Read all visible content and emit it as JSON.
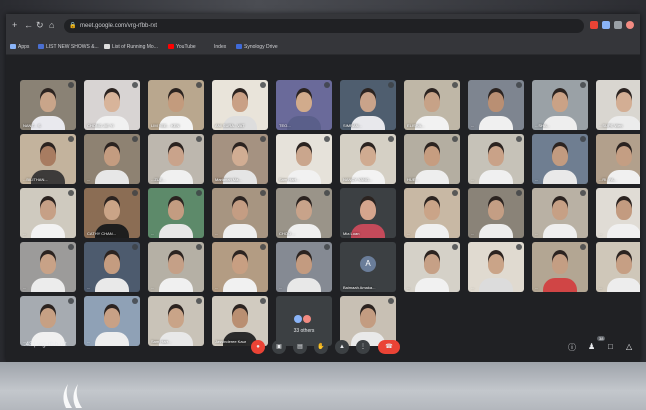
{
  "browser": {
    "url": "meet.google.com/vrg-rfbb-rxt",
    "bookmarks": [
      {
        "label": "Apps"
      },
      {
        "label": "LIST NEW SHOWS &..."
      },
      {
        "label": "List of Running Mo..."
      },
      {
        "label": "YouTube"
      },
      {
        "label": "Index"
      },
      {
        "label": "Synology Drive"
      }
    ]
  },
  "meeting": {
    "time": ":43",
    "code": "vrg-rfbb-rxt",
    "participant_count": "38"
  },
  "participants": [
    {
      "name": "NANT... S",
      "bg": "#8a8275",
      "skin": "#c9a58a",
      "shirt": "#e9e9ee",
      "type": "video"
    },
    {
      "name": "CHONG JIE YI",
      "bg": "#d8d4d3",
      "skin": "#d8b49a",
      "shirt": "#f1f1f1",
      "type": "video"
    },
    {
      "name": "LIM YEE... KEN",
      "bg": "#b9a78e",
      "skin": "#c39b7d",
      "shirt": "#f4f4f4",
      "type": "video"
    },
    {
      "name": "ANI SURA...VAT",
      "bg": "#e9e4da",
      "skin": "#c9a085",
      "shirt": "#dddddd",
      "type": "video"
    },
    {
      "name": "TEO...",
      "bg": "#6a6a9a",
      "skin": "#d1ab8c",
      "shirt": "#5a5f8a",
      "type": "video"
    },
    {
      "name": "SIMRAN...",
      "bg": "#4f5e6f",
      "skin": "#c9a38a",
      "shirt": "#e8e8ec",
      "type": "video"
    },
    {
      "name": "ELISHA...",
      "bg": "#bfb7a7",
      "skin": "#c7a287",
      "shirt": "#f2f2f2",
      "type": "video"
    },
    {
      "name": "...",
      "bg": "#7e8590",
      "skin": "#b98f73",
      "shirt": "#f0f0f0",
      "type": "video"
    },
    {
      "name": "...SHA...",
      "bg": "#9aa1a6",
      "skin": "#caa286",
      "shirt": "#eeeeee",
      "type": "video"
    },
    {
      "name": "...SUPE Wen",
      "bg": "#d9d6d0",
      "skin": "#d3ae94",
      "shirt": "#ececec",
      "type": "video"
    },
    {
      "name": "...BILITHAN...",
      "bg": "#c3b39d",
      "skin": "#a87c61",
      "shirt": "#3d3b3a",
      "type": "video"
    },
    {
      "name": "...",
      "bg": "#8e8272",
      "skin": "#c49c80",
      "shirt": "#e7e7e7",
      "type": "video"
    },
    {
      "name": "...ZUE...",
      "bg": "#bdb7ae",
      "skin": "#c9a38b",
      "shirt": "#f0f0f0",
      "type": "video"
    },
    {
      "name": "Marianah Ma...",
      "bg": "#a59281",
      "skin": "#d1ad93",
      "shirt": "#e5e5e5",
      "type": "video"
    },
    {
      "name": "Sam Hart...",
      "bg": "#e6e2da",
      "skin": "#caa68d",
      "shirt": "#f1f1f1",
      "type": "video"
    },
    {
      "name": "NANCY YANG...",
      "bg": "#d5d0c5",
      "skin": "#d0ab91",
      "shirt": "#f3f3f3",
      "type": "video"
    },
    {
      "name": "HUE...",
      "bg": "#b4aea1",
      "skin": "#c69d80",
      "shirt": "#eeeeee",
      "type": "video"
    },
    {
      "name": "...",
      "bg": "#c6c2b8",
      "skin": "#c9a288",
      "shirt": "#f0f0f0",
      "type": "video"
    },
    {
      "name": "...",
      "bg": "#6f7e91",
      "skin": "#c29b80",
      "shirt": "#e9e9e9",
      "type": "video"
    },
    {
      "name": "...RI..YA...",
      "bg": "#b2a08c",
      "skin": "#c49e83",
      "shirt": "#f0f0f0",
      "type": "video"
    },
    {
      "name": "...",
      "bg": "#cfcabf",
      "skin": "#c6a086",
      "shirt": "#f2f2f2",
      "type": "video"
    },
    {
      "name": "CATHY CHAN...",
      "bg": "#8b6d54",
      "skin": "#caa487",
      "shirt": "#1e1e1e",
      "type": "video"
    },
    {
      "name": "...",
      "bg": "#5d8a6a",
      "skin": "#c39c81",
      "shirt": "#e7e7e7",
      "type": "video"
    },
    {
      "name": "...",
      "bg": "#a79581",
      "skin": "#c49d83",
      "shirt": "#eeeeee",
      "type": "video"
    },
    {
      "name": "CHOO ...",
      "bg": "#9a9489",
      "skin": "#c8a38a",
      "shirt": "#efefef",
      "type": "video"
    },
    {
      "name": "Mia Loan",
      "bg": "#3c4043",
      "skin": "#d5a58d",
      "shirt": "#c44a5a",
      "type": "video"
    },
    {
      "name": "...",
      "bg": "#c8b8a4",
      "skin": "#caa488",
      "shirt": "#f0f0f0",
      "type": "video"
    },
    {
      "name": "...",
      "bg": "#8a8378",
      "skin": "#c49e84",
      "shirt": "#ededed",
      "type": "video"
    },
    {
      "name": "...",
      "bg": "#b9b1a4",
      "skin": "#c6a085",
      "shirt": "#efefef",
      "type": "video"
    },
    {
      "name": "...",
      "bg": "#e0dcd5",
      "skin": "#c39b80",
      "shirt": "#f0f0f0",
      "type": "video"
    },
    {
      "name": "...",
      "bg": "#9c9b9a",
      "skin": "#c8a287",
      "shirt": "#ececec",
      "type": "video"
    },
    {
      "name": "...",
      "bg": "#4d5b6e",
      "skin": "#c49c80",
      "shirt": "#e9e9e9",
      "type": "video"
    },
    {
      "name": "...",
      "bg": "#b5b0a5",
      "skin": "#c5a087",
      "shirt": "#f0f0f0",
      "type": "video"
    },
    {
      "name": "...",
      "bg": "#b39c83",
      "skin": "#c89f82",
      "shirt": "#f1f1f1",
      "type": "video"
    },
    {
      "name": "...",
      "bg": "#858a93",
      "skin": "#c39b80",
      "shirt": "#e8e8e8",
      "type": "video"
    },
    {
      "name": "Baimaah Amaka...",
      "bg": "#3c4043",
      "initial": "A",
      "type": "avatar"
    },
    {
      "name": "...",
      "bg": "#d5d1c8",
      "skin": "#c6a086",
      "shirt": "#f1f1f1",
      "type": "video"
    },
    {
      "name": "...",
      "bg": "#e0dad0",
      "skin": "#caa488",
      "shirt": "#dcdcdc",
      "type": "video"
    },
    {
      "name": "...",
      "bg": "#b3a693",
      "skin": "#c49e83",
      "shirt": "#d04545",
      "type": "video"
    },
    {
      "name": "...",
      "bg": "#cfc7b9",
      "skin": "#c69f84",
      "shirt": "#ededed",
      "type": "video"
    },
    {
      "name": "...",
      "bg": "#a6abb1",
      "skin": "#c6a084",
      "shirt": "#f0f0f0",
      "type": "video"
    },
    {
      "name": "...",
      "bg": "#8fa1b6",
      "skin": "#c8a186",
      "shirt": "#eeeeee",
      "type": "video"
    },
    {
      "name": "Sam Harr...",
      "bg": "#c9c3b8",
      "skin": "#c9a488",
      "shirt": "#e8e8e8",
      "type": "video"
    },
    {
      "name": "Jasvinderee Kaur",
      "bg": "#d1cbc0",
      "skin": "#b98f72",
      "shirt": "#2b2b2b",
      "type": "video"
    },
    {
      "name": "",
      "bg": "#3c4043",
      "type": "others",
      "others_label": "33 others"
    },
    {
      "name": "...",
      "bg": "#c8c0b4",
      "skin": "#c39c81",
      "shirt": "#e9e9e9",
      "type": "video"
    }
  ]
}
